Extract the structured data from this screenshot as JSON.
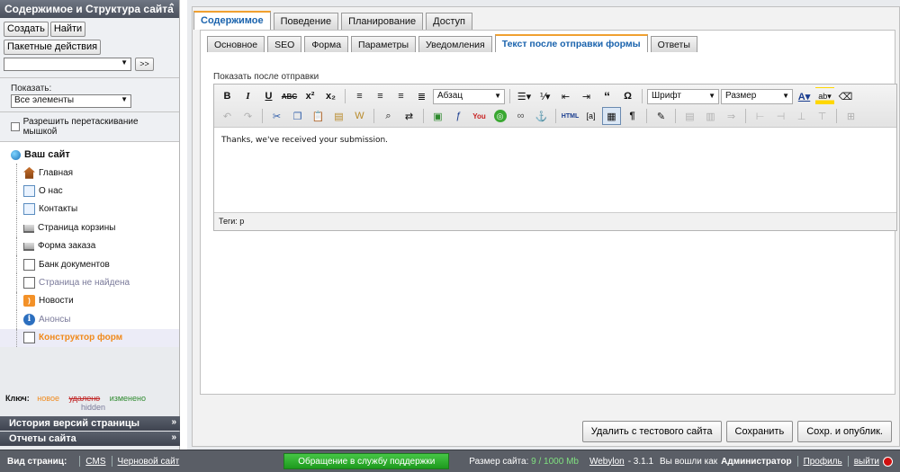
{
  "sidebar": {
    "title": "Содержимое и Структура сайта",
    "buttons": {
      "create": "Создать",
      "find": "Найти",
      "batch": "Пакетные действия",
      "go": ">>"
    },
    "show_label": "Показать:",
    "show_value": "Все элементы",
    "drag_label": "Разрешить перетаскивание мышкой",
    "root": "Ваш сайт",
    "items": [
      {
        "label": "Главная"
      },
      {
        "label": "О нас"
      },
      {
        "label": "Контакты"
      },
      {
        "label": "Страница корзины"
      },
      {
        "label": "Форма заказа"
      },
      {
        "label": "Банк документов"
      },
      {
        "label": "Страница не найдена"
      },
      {
        "label": "Новости"
      },
      {
        "label": "Анонсы"
      },
      {
        "label": "Конструктор форм"
      }
    ],
    "key": {
      "label": "Ключ:",
      "new": "новое",
      "deleted": "удалено",
      "changed": "изменено",
      "hidden": "hidden"
    },
    "history": "История версий страницы",
    "reports": "Отчеты сайта"
  },
  "tabs": [
    "Содержимое",
    "Поведение",
    "Планирование",
    "Доступ"
  ],
  "subtabs": [
    "Основное",
    "SEO",
    "Форма",
    "Параметры",
    "Уведомления",
    "Текст после отправки формы",
    "Ответы"
  ],
  "editor": {
    "label": "Показать после отправки",
    "format_select": "Абзац",
    "font_select": "Шрифт",
    "size_select": "Размер",
    "content": "Thanks, we've received your submission.",
    "status": "Теги: p"
  },
  "actions": {
    "delete": "Удалить с тестового сайта",
    "save": "Сохранить",
    "save_publish": "Сохр. и опублик."
  },
  "footer": {
    "view_label": "Вид страниц:",
    "cms": "CMS",
    "draft": "Черновой сайт",
    "support": "Обращение в службу поддержки",
    "size_label": "Размер сайта:",
    "size_value": "9 / 1000 Mb",
    "brand": "Webylon",
    "version": "- 3.1.1",
    "logged_prefix": "Вы вошли как",
    "user": "Администратор",
    "profile": "Профиль",
    "logout": "выйти"
  },
  "colors": {
    "accent": "#1a63ad",
    "tab_highlight": "#f0a030",
    "support_green": "#2aa82a",
    "active_item": "#f08a1c"
  }
}
